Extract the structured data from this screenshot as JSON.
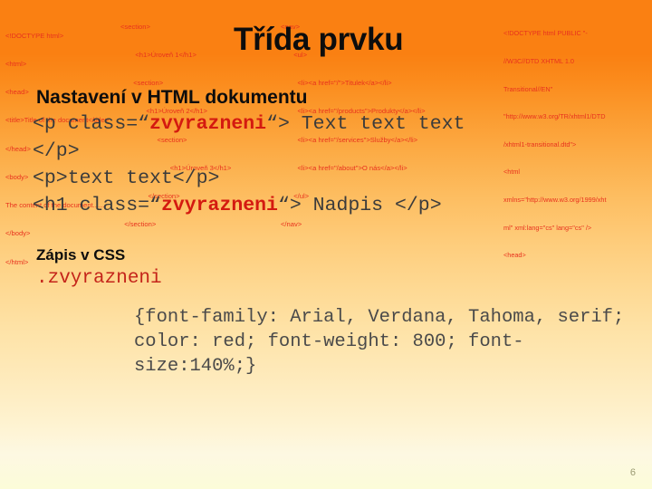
{
  "slide": {
    "title": "Třída prvku",
    "page_number": "6"
  },
  "code_columns": {
    "left": {
      "name": "html-skeleton-snippet",
      "lines": [
        "<!DOCTYPE html>",
        "<html>",
        "<head>",
        "<title>Title of the document</title>",
        "</head>",
        "<body>",
        "The content of the document......",
        "</body>",
        "</html>"
      ]
    },
    "middle": {
      "name": "sections-and-nav-snippet",
      "lines": [
        "<section>",
        "   <h1>Úroveň 1</h1>",
        "  <section>",
        "    <h1>Úroveň 2</h1>",
        "     <section>",
        "       <h1>Úroveň 3</h1>",
        "     </section>",
        "  </section>"
      ],
      "nav_lines": [
        "<nav>",
        "  <ul>",
        "    <li><a href=\"/\">Titulek</a></li>",
        "    <li><a href=\"/products\">Produkty</a></li>",
        "    <li><a href=\"/services\">Služby</a></li>",
        "    <li><a href=\"/about\">O nás</a></li>",
        "  </ul>",
        "</nav>"
      ]
    },
    "right": {
      "name": "xhtml-doctype-snippet",
      "lines": [
        "<!DOCTYPE html PUBLIC \"-",
        "//W3C//DTD XHTML 1.0",
        "Transitional//EN\"",
        "\"http://www.w3.org/TR/xhtml1/DTD",
        "/xhtml1-transitional.dtd\">",
        "<html",
        "xmlns=\"http://www.w3.org/1999/xht",
        "ml\" xml:lang=\"cs\" lang=\"cs\" />",
        "<head>"
      ]
    }
  },
  "html_section": {
    "heading": "Nastavení v HTML dokumentu",
    "code": {
      "line1_before": "<p class=“",
      "line1_class": "zvyrazneni",
      "line1_after": "“> Text text text\n</p>",
      "line2": "<p>text text</p>",
      "line3_before": "<h1 class=“",
      "line3_class": "zvyrazneni",
      "line3_after": "“> Nadpis </p>"
    }
  },
  "css_section": {
    "heading": "Zápis v CSS",
    "selector": ".zvyrazneni",
    "body": "{font-family: Arial, Verdana, Tahoma, serif; color: red; font-weight: 800; font-size:140%;}"
  },
  "colors": {
    "code_red": "#e8321e",
    "highlight_red": "#d41a10",
    "title_black": "#0d0d0d",
    "mono_gray": "#3b3b3b",
    "background_top": "#fa8012",
    "background_bottom": "#fcfcd8",
    "page_number": "#9a9a72"
  }
}
